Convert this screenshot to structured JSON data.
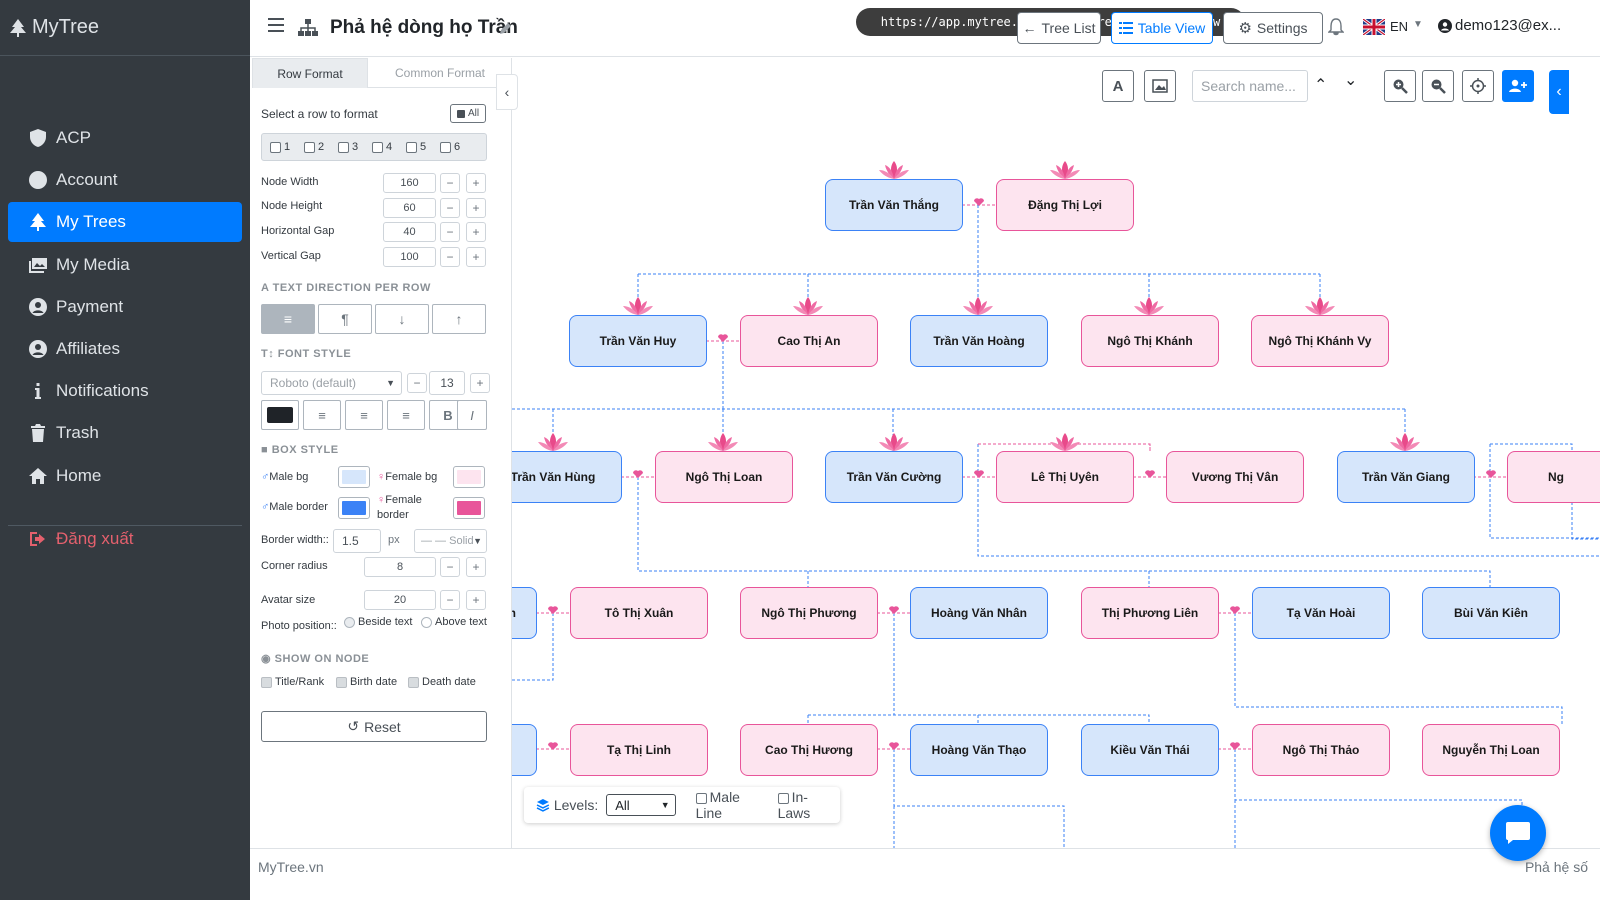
{
  "sidebar": {
    "brand": "MyTree",
    "items": [
      {
        "label": "ACP",
        "icon": "shield-icon"
      },
      {
        "label": "Account",
        "icon": "user-circle-icon"
      },
      {
        "label": "My Trees",
        "icon": "tree-icon"
      },
      {
        "label": "My Media",
        "icon": "images-icon"
      },
      {
        "label": "Payment",
        "icon": "user-circle-icon"
      },
      {
        "label": "Affiliates",
        "icon": "user-circle-icon"
      },
      {
        "label": "Notifications",
        "icon": "info-icon"
      },
      {
        "label": "Trash",
        "icon": "trash-icon"
      },
      {
        "label": "Home",
        "icon": "home-icon"
      }
    ],
    "logout": "Đăng xuất"
  },
  "topbar": {
    "title": "Phả hệ dòng họ Trần",
    "url": "https://app.mytree.vn/member/trees/1000972/view",
    "tree_list": "Tree List",
    "table_view": "Table View",
    "settings": "Settings",
    "language": "EN",
    "user": "demo123@ex..."
  },
  "panel": {
    "tab_row": "Row Format",
    "tab_common": "Common Format",
    "select_row": "Select a row to format",
    "all": "All",
    "rows": [
      "1",
      "2",
      "3",
      "4",
      "5",
      "6"
    ],
    "node_width_label": "Node Width",
    "node_width": "160",
    "node_height_label": "Node Height",
    "node_height": "60",
    "hgap_label": "Horizontal Gap",
    "hgap": "40",
    "vgap_label": "Vertical Gap",
    "vgap": "100",
    "text_direction": "TEXT DIRECTION PER ROW",
    "font_style": "FONT STYLE",
    "font_family": "Roboto (default)",
    "font_size": "13",
    "box_style": "BOX STYLE",
    "male_bg": "Male bg",
    "female_bg": "Female bg",
    "male_border": "Male border",
    "female_border": "Female border",
    "border_width_label": "Border width::",
    "border_width": "1.5",
    "px": "px",
    "border_style": "— — Solid",
    "corner_radius_label": "Corner radius",
    "corner_radius": "8",
    "avatar_size_label": "Avatar size",
    "avatar_size": "20",
    "photo_position_label": "Photo position::",
    "beside_text": "Beside text",
    "above_text": "Above text",
    "show_on_node": "SHOW ON NODE",
    "title_rank": "Title/Rank",
    "birth_date": "Birth date",
    "death_date": "Death date",
    "reset": "Reset",
    "colors": {
      "male_bg": "#d6e6fb",
      "female_bg": "#fde4ef",
      "male_border": "#3b82f6",
      "female_border": "#e8559a",
      "text": "#1f2328"
    }
  },
  "canvas": {
    "search_placeholder": "Search name...",
    "levels_label": "Levels:",
    "levels_value": "All",
    "male_line": "Male Line",
    "in_laws": "In-Laws"
  },
  "tree": {
    "row1": [
      "Trần Văn Thắng",
      "Đặng Thị Lợi"
    ],
    "row2": [
      "Trần Văn Huy",
      "Cao Thị An",
      "Trần Văn Hoàng",
      "Ngô Thị Khánh",
      "Ngô Thị Khánh Vy"
    ],
    "row3": [
      "Trần Văn Hùng",
      "Ngô Thị Loan",
      "Trần Văn Cường",
      "Lê Thị Uyên",
      "Vương Thị Vân",
      "Trần Văn Giang",
      "Ng"
    ],
    "row4": [
      "n",
      "Tô Thị Xuân",
      "Ngô Thị Phương",
      "Hoàng Văn Nhân",
      "Thị Phương Liên",
      "Tạ Văn Hoài",
      "Bùi Văn Kiên"
    ],
    "row5": [
      "",
      "Tạ Thị Linh",
      "Cao Thị Hương",
      "Hoàng Văn Thạo",
      "Kiều Văn Thái",
      "Ngô Thị Thảo",
      "Nguyễn Thị Loan"
    ]
  },
  "footer": {
    "left": "MyTree.vn",
    "right": "Phả hệ số"
  }
}
